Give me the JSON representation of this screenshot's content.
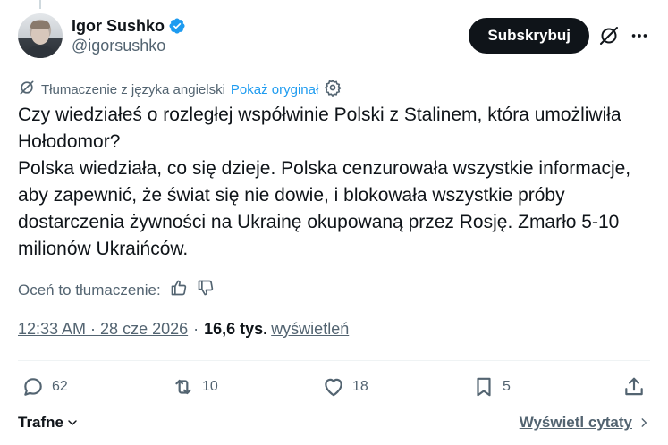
{
  "author": {
    "name": "Igor Sushko",
    "handle": "@igorsushko"
  },
  "header": {
    "subscribe_label": "Subskrybuj"
  },
  "translation": {
    "from_label": "Tłumaczenie z języka angielski",
    "show_original_label": "Pokaż oryginał"
  },
  "tweet": {
    "text": "Czy wiedziałeś o rozległej współwinie Polski z Stalinem, która umożliwiła Hołodomor?\nPolska wiedziała, co się dzieje. Polska cenzurowała wszystkie informacje, aby zapewnić, że świat się nie dowie, i blokowała wszystkie próby dostarczenia żywności na Ukrainę okupowaną przez Rosję. Zmarło 5-10 milionów Ukraińców."
  },
  "rating": {
    "label": "Oceń to tłumaczenie:"
  },
  "meta": {
    "timestamp": "12:33 AM · 28 cze 2026",
    "separator": "·",
    "views_count": "16,6 tys.",
    "views_label": "wyświetleń"
  },
  "actions": {
    "replies": "62",
    "reposts": "10",
    "likes": "18",
    "bookmarks": "5"
  },
  "bottom": {
    "sort_label": "Trafne",
    "quotes_label": "Wyświetl cytaty"
  },
  "colors": {
    "accent": "#1d9bf0",
    "text_primary": "#0f1419",
    "text_secondary": "#536471",
    "divider": "#eff3f4"
  },
  "icons": [
    "verified-badge-icon",
    "grok-icon",
    "more-icon",
    "translate-icon",
    "settings-icon",
    "thumbs-up-icon",
    "thumbs-down-icon",
    "reply-icon",
    "repost-icon",
    "like-icon",
    "bookmark-icon",
    "share-icon",
    "chevron-down-icon",
    "chevron-right-icon"
  ]
}
